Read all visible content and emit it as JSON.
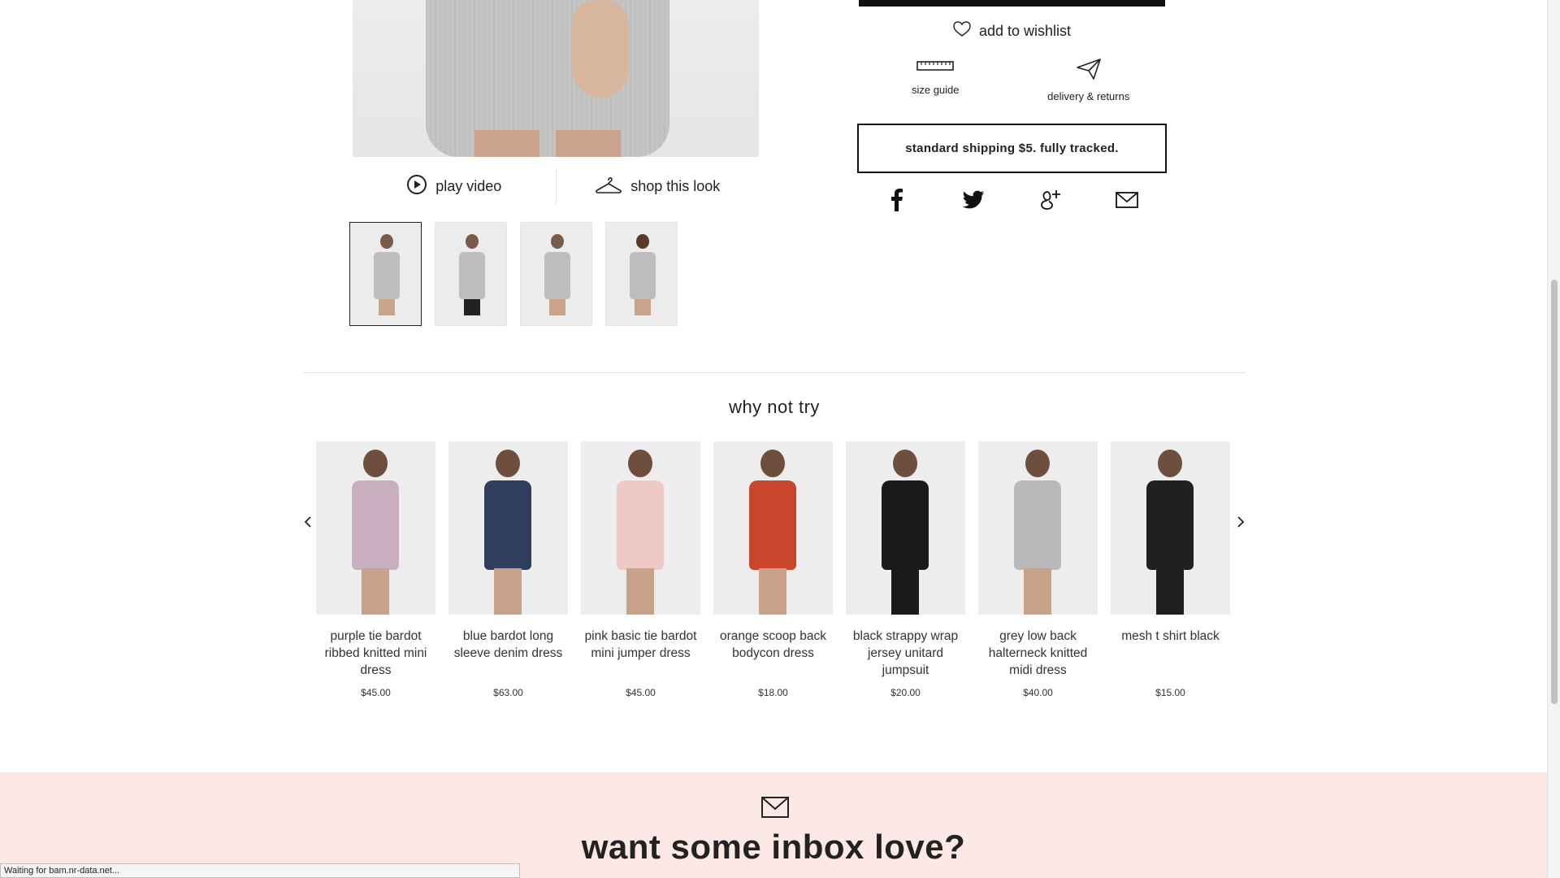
{
  "media": {
    "play_video": "play video",
    "shop_this_look": "shop this look"
  },
  "product_actions": {
    "wishlist": "add to wishlist",
    "size_guide": "size guide",
    "delivery_returns": "delivery & returns",
    "shipping_note": "standard shipping $5. fully tracked."
  },
  "share": {
    "icons": [
      "facebook-icon",
      "twitter-icon",
      "google-plus-icon",
      "email-icon"
    ]
  },
  "recommendations": {
    "title": "why not try",
    "items": [
      {
        "name": "purple tie bardot ribbed knitted mini dress",
        "price": "$45.00",
        "color": "#c9aec0"
      },
      {
        "name": "blue bardot long sleeve denim dress",
        "price": "$63.00",
        "color": "#2e3e5c"
      },
      {
        "name": "pink basic tie bardot mini jumper dress",
        "price": "$45.00",
        "color": "#efc9c4"
      },
      {
        "name": "orange scoop back bodycon dress",
        "price": "$18.00",
        "color": "#c8472c"
      },
      {
        "name": "black strappy wrap jersey unitard jumpsuit",
        "price": "$20.00",
        "color": "#1a1a1a"
      },
      {
        "name": "grey low back halterneck knitted midi dress",
        "price": "$40.00",
        "color": "#b9b9b9"
      },
      {
        "name": "mesh t shirt black",
        "price": "$15.00",
        "color": "#202020"
      }
    ]
  },
  "newsletter": {
    "headline": "want some inbox love?"
  },
  "status": "Waiting for bam.nr-data.net..."
}
